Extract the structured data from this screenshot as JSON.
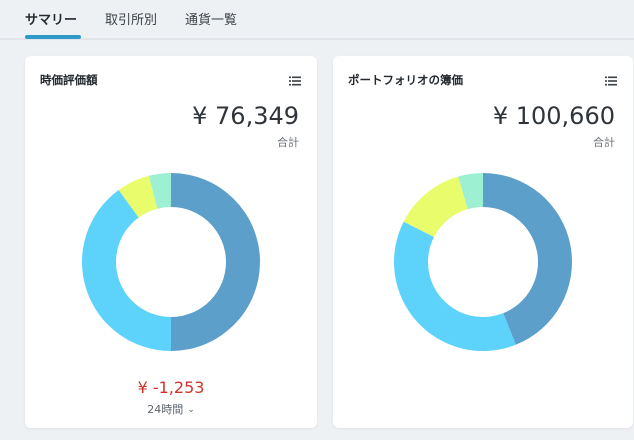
{
  "tabs": [
    {
      "label": "サマリー",
      "active": true
    },
    {
      "label": "取引所別",
      "active": false
    },
    {
      "label": "通貨一覧",
      "active": false
    }
  ],
  "cards": [
    {
      "title": "時価評価額",
      "amount": "¥ 76,349",
      "total_label": "合計",
      "change": "¥ -1,253",
      "period": "24時間",
      "menu_icon": "list-icon"
    },
    {
      "title": "ポートフォリオの簿価",
      "amount": "¥ 100,660",
      "total_label": "合計",
      "menu_icon": "list-icon"
    }
  ],
  "colors": {
    "accent": "#2e9ac7",
    "negative": "#d0332b",
    "slice_1": "#5b9fca",
    "slice_2": "#5dd3fb",
    "slice_3": "#e9fd6c",
    "slice_4": "#9ef0d2"
  },
  "chart_data": [
    {
      "type": "pie",
      "variant": "donut",
      "values": [
        50,
        40,
        6,
        4
      ]
    },
    {
      "type": "pie",
      "variant": "donut",
      "values": [
        44,
        38.5,
        13,
        4.5
      ]
    }
  ]
}
